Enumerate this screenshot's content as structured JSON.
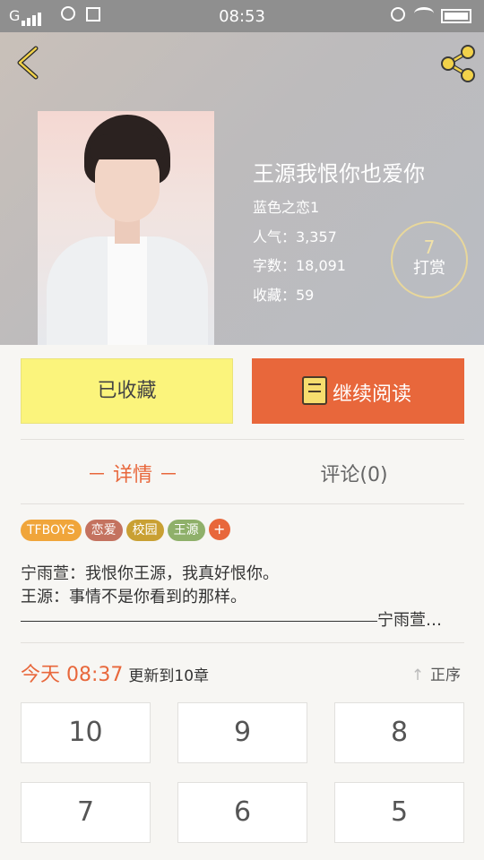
{
  "status_bar": {
    "carrier": "G",
    "time": "08:53"
  },
  "book": {
    "title": "王源我恨你也爱你",
    "author": "蓝色之恋1",
    "popularity": "人气：3,357",
    "word_count": "字数：18,091",
    "favorites": "收藏：59"
  },
  "reward": {
    "count": "7",
    "label": "打赏"
  },
  "actions": {
    "favorited_label": "已收藏",
    "continue_label": "继续阅读"
  },
  "tabs": {
    "detail": "－ 详情 －",
    "comments": "评论(0)"
  },
  "tags": [
    {
      "label": "TFBOYS",
      "color": "#f0a53a"
    },
    {
      "label": "恋爱",
      "color": "#c4725f"
    },
    {
      "label": "校园",
      "color": "#c9a033"
    },
    {
      "label": "王源",
      "color": "#8fb06a"
    }
  ],
  "tag_add": "+",
  "synopsis": {
    "line1": "宁雨萱：我恨你王源，我真好恨你。",
    "line2": "王源：事情不是你看到的那样。",
    "line3_tail": "宁雨萱…"
  },
  "update": {
    "time": "今天 08:37",
    "text": "更新到10章"
  },
  "sort": {
    "label": "正序",
    "arrow": "↑"
  },
  "chapters": [
    "10",
    "9",
    "8",
    "7",
    "6",
    "5"
  ],
  "colors": {
    "accent": "#e8673b",
    "favorite_button": "#fbf47c"
  }
}
